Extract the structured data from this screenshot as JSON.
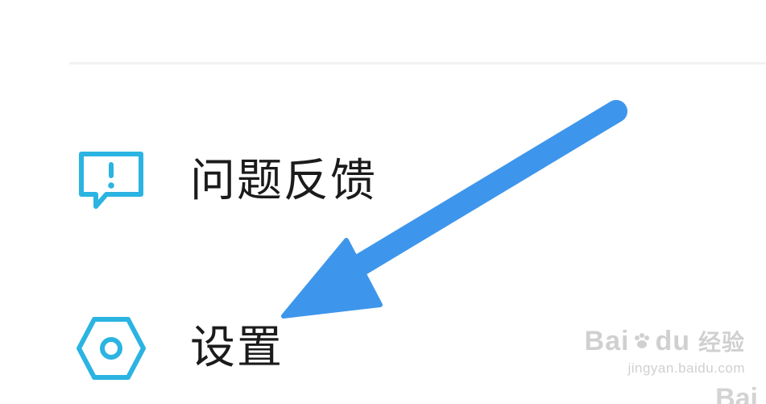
{
  "menu": {
    "items": [
      {
        "label": "问题反馈",
        "icon": "feedback-exclamation-icon"
      },
      {
        "label": "设置",
        "icon": "settings-hexagon-icon"
      }
    ]
  },
  "colors": {
    "icon_accent": "#2bb4e2",
    "arrow": "#3d96eb",
    "text": "#1b1b1b"
  },
  "watermark": {
    "brand": "Bai",
    "brand_suffix": "du",
    "brand_zh": "经验",
    "url": "jingyan.baidu.com"
  }
}
